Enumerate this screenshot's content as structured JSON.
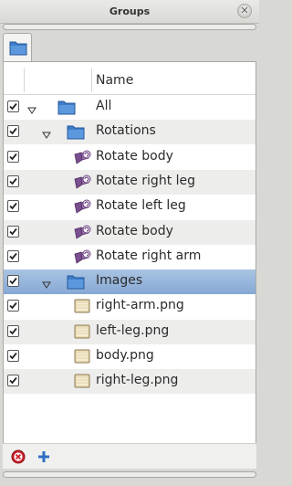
{
  "window": {
    "title": "Groups",
    "close_icon": "close-icon"
  },
  "tab": {
    "icon": "folder-icon"
  },
  "table": {
    "column_name": "Name",
    "rows": [
      {
        "label": "All",
        "checked": true,
        "icon": "folder-icon",
        "expanded": true
      },
      {
        "label": "Rotations",
        "checked": true,
        "icon": "folder-icon",
        "expanded": true
      },
      {
        "label": "Rotate body",
        "checked": true,
        "icon": "rotate-action-icon"
      },
      {
        "label": "Rotate right leg",
        "checked": true,
        "icon": "rotate-action-icon"
      },
      {
        "label": "Rotate left leg",
        "checked": true,
        "icon": "rotate-action-icon"
      },
      {
        "label": "Rotate body",
        "checked": true,
        "icon": "rotate-action-icon"
      },
      {
        "label": "Rotate right arm",
        "checked": true,
        "icon": "rotate-action-icon"
      },
      {
        "label": "Images",
        "checked": true,
        "icon": "folder-icon",
        "expanded": true,
        "selected": true
      },
      {
        "label": "right-arm.png",
        "checked": true,
        "icon": "image-file-icon"
      },
      {
        "label": "left-leg.png",
        "checked": true,
        "icon": "image-file-icon"
      },
      {
        "label": "body.png",
        "checked": true,
        "icon": "image-file-icon"
      },
      {
        "label": "right-leg.png",
        "checked": true,
        "icon": "image-file-icon"
      }
    ]
  },
  "toolbar": {
    "remove_icon": "remove-icon",
    "add_icon": "add-icon"
  },
  "colors": {
    "selection": "#8fb0d9",
    "folder": "#3d7dca",
    "remove": "#cc1f2a",
    "add": "#2f6fc3"
  }
}
